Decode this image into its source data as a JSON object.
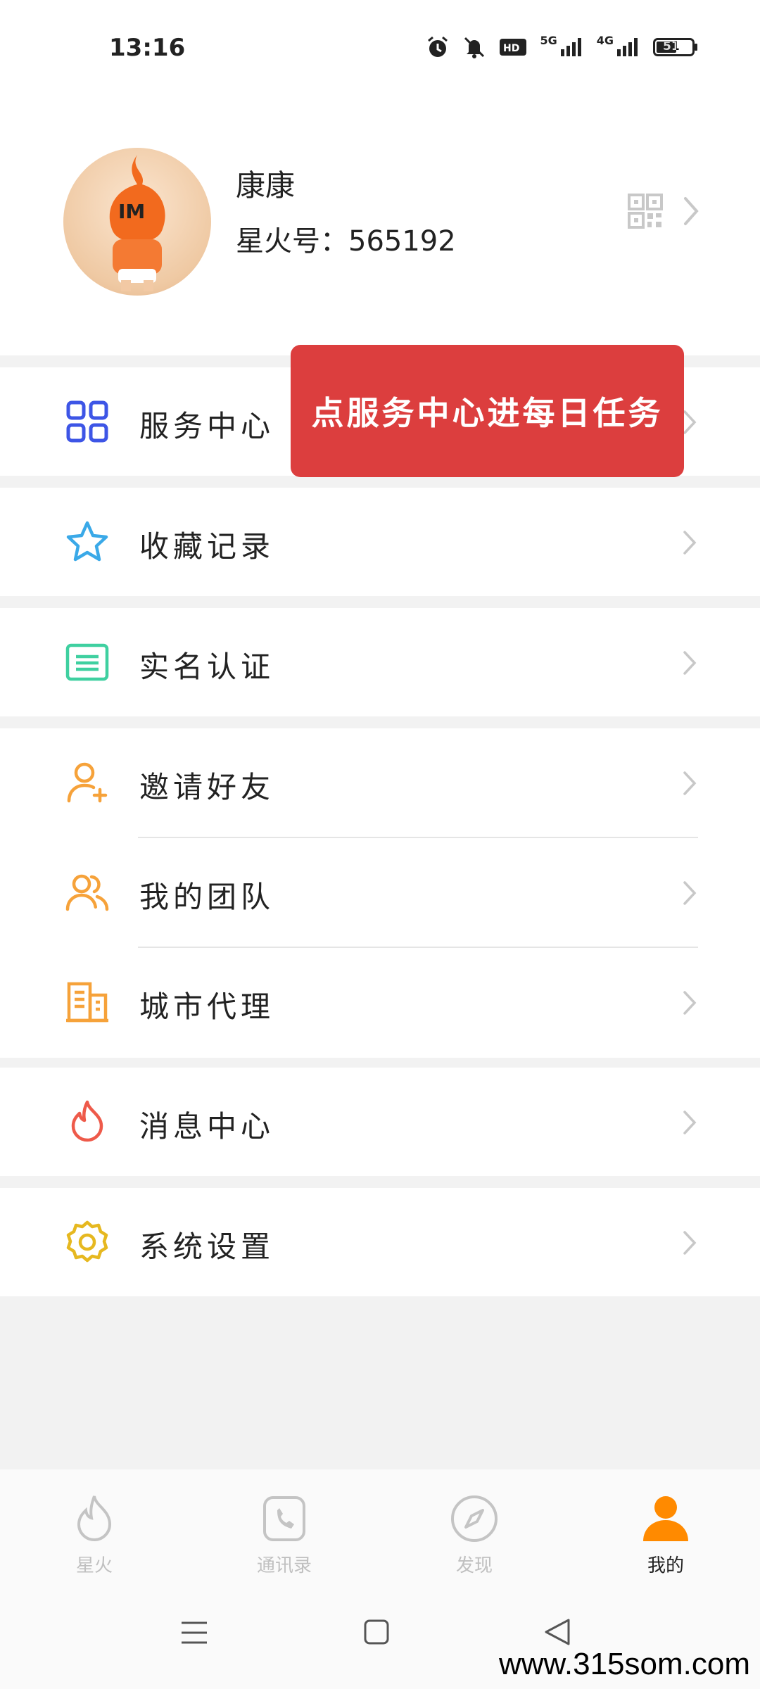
{
  "status_bar": {
    "time": "13:16",
    "battery": "51",
    "network_1": "5G",
    "network_2": "4G"
  },
  "profile": {
    "nickname": "康康",
    "spark_id": "星火号：565192",
    "avatar_icon": "mascot-avatar",
    "avatar_text": "IM"
  },
  "banner": {
    "text": "点服务中心进每日任务",
    "color": "#dc3e3e"
  },
  "menu": {
    "service_center": "服务中心",
    "favorites": "收藏记录",
    "real_name": "实名认证",
    "invite_friends": "邀请好友",
    "my_team": "我的团队",
    "city_agent": "城市代理",
    "message_center": "消息中心",
    "system_settings": "系统设置"
  },
  "tabs": {
    "spark": "星火",
    "contacts": "通讯录",
    "discover": "发现",
    "mine": "我的"
  },
  "colors": {
    "accent": "#ff8a00",
    "blue": "#3d55e6",
    "cyan": "#3aa9e8",
    "teal": "#3fd0a0",
    "orange": "#f6a23a",
    "red": "#ee5a4a",
    "yellow": "#e6b820"
  },
  "watermark": "www.315som.com"
}
